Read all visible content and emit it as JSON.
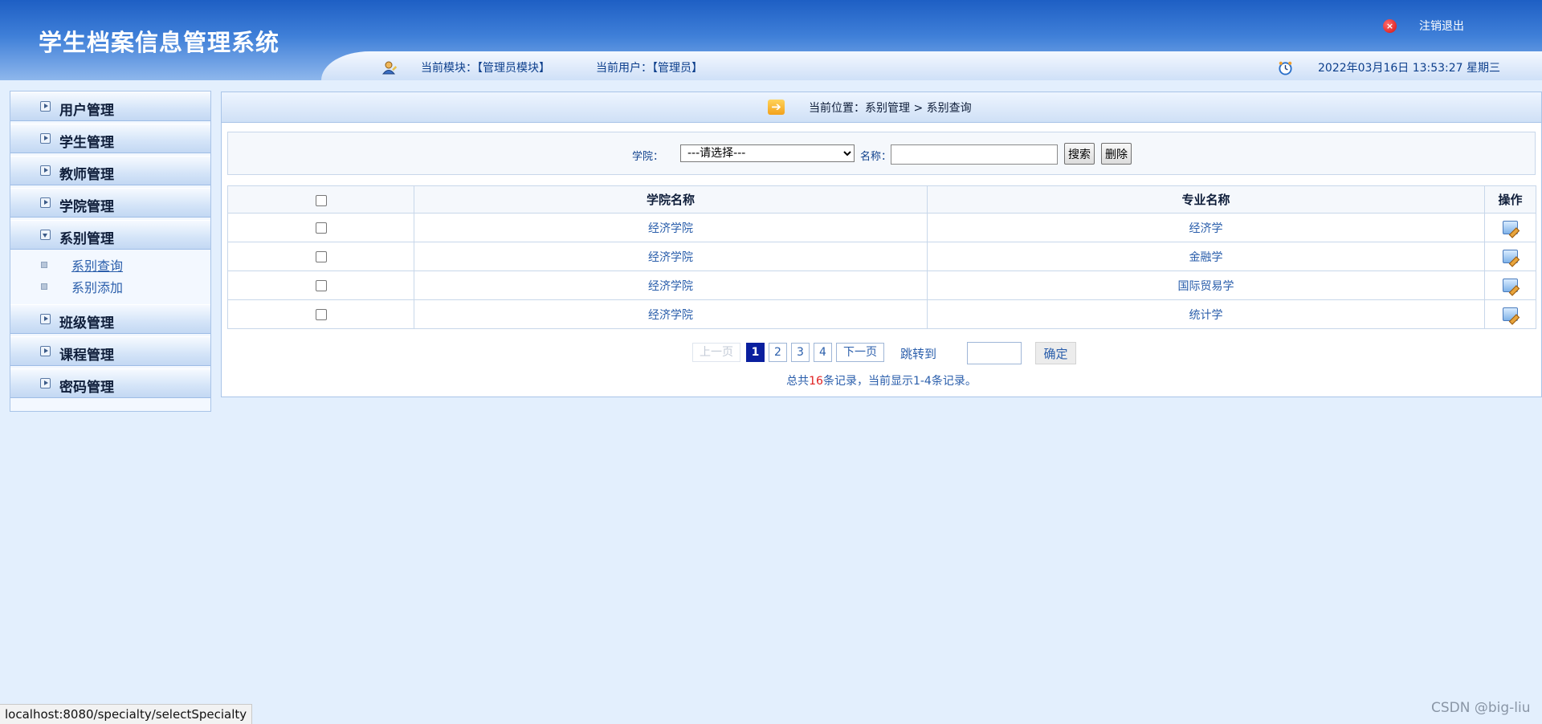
{
  "header": {
    "title": "学生档案信息管理系统",
    "logout_label": "注销退出",
    "module_text": "当前模块：【管理员模块】",
    "user_text": "当前用户：【管理员】",
    "datetime": "2022年03月16日 13:53:27 星期三"
  },
  "sidebar": {
    "items": [
      {
        "label": "用户管理",
        "expanded": false
      },
      {
        "label": "学生管理",
        "expanded": false
      },
      {
        "label": "教师管理",
        "expanded": false
      },
      {
        "label": "学院管理",
        "expanded": false
      },
      {
        "label": "系别管理",
        "expanded": true
      },
      {
        "label": "班级管理",
        "expanded": false
      },
      {
        "label": "课程管理",
        "expanded": false
      },
      {
        "label": "密码管理",
        "expanded": false
      }
    ],
    "sub_items": [
      {
        "label": "系别查询",
        "active": true
      },
      {
        "label": "系别添加",
        "active": false
      }
    ]
  },
  "breadcrumb": {
    "text": "当前位置：系别管理 > 系别查询"
  },
  "search": {
    "college_label": "学院：",
    "college_selected": "---请选择---",
    "name_label": "名称：",
    "name_value": "",
    "search_button": "搜索",
    "delete_button": "删除"
  },
  "table": {
    "headers": [
      "",
      "学院名称",
      "专业名称",
      "操作"
    ],
    "rows": [
      {
        "college": "经济学院",
        "specialty": "经济学"
      },
      {
        "college": "经济学院",
        "specialty": "金融学"
      },
      {
        "college": "经济学院",
        "specialty": "国际贸易学"
      },
      {
        "college": "经济学院",
        "specialty": "统计学"
      }
    ]
  },
  "pagination": {
    "prev": "上一页",
    "pages": [
      "1",
      "2",
      "3",
      "4"
    ],
    "current_page": "1",
    "next": "下一页",
    "goto_label": "跳转到",
    "goto_value": "",
    "confirm": "确定",
    "summary_prefix": "总共",
    "summary_total": "16",
    "summary_suffix": "条记录，当前显示1-4条记录。"
  },
  "status_bar": {
    "url": "localhost:8080/specialty/selectSpecialty"
  },
  "watermark": "CSDN @big-liu"
}
